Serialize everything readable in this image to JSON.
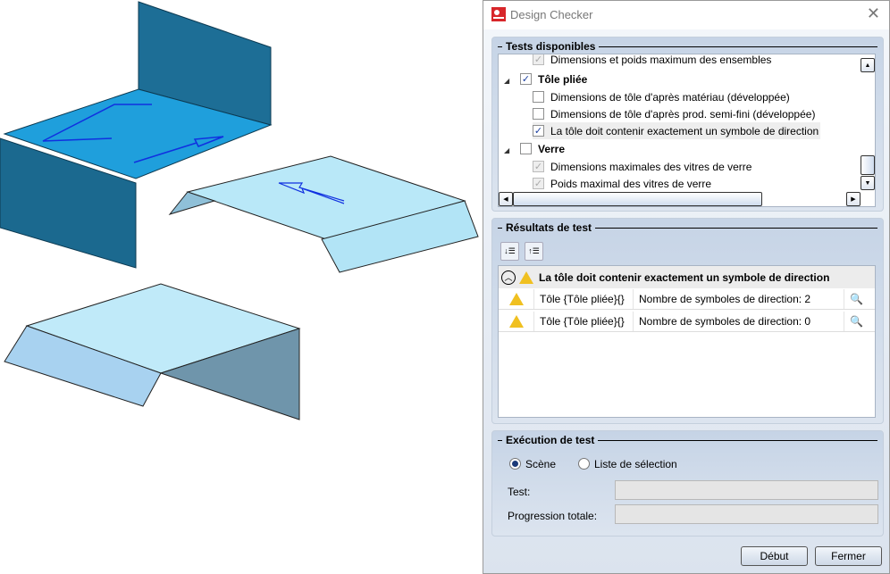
{
  "window": {
    "title": "Design Checker",
    "close": "✕"
  },
  "tests": {
    "title": "Tests disponibles",
    "items": [
      {
        "label": "Dimensions et poids maximum des ensembles",
        "checked": true,
        "disabled": true
      },
      {
        "label": "Tôle pliée",
        "checked": true,
        "group": true
      },
      {
        "label": "Dimensions de tôle d'après matériau (développée)",
        "checked": false
      },
      {
        "label": "Dimensions de tôle d'après prod. semi-fini (développée)",
        "checked": false
      },
      {
        "label": "La tôle doit contenir exactement un symbole de direction",
        "checked": true
      },
      {
        "label": "Verre",
        "checked": false,
        "group": true
      },
      {
        "label": "Dimensions maximales des vitres de verre",
        "checked": true,
        "disabled": true
      },
      {
        "label": "Poids maximal des vitres de verre",
        "checked": true,
        "disabled": true
      }
    ]
  },
  "results": {
    "title": "Résultats de test",
    "header": "La tôle doit contenir exactement un symbole de direction",
    "rows": [
      {
        "object": "Tôle {Tôle pliée}{}",
        "message": "Nombre de symboles de direction: 2"
      },
      {
        "object": "Tôle {Tôle pliée}{}",
        "message": "Nombre de symboles de direction: 0"
      }
    ]
  },
  "execution": {
    "title": "Exécution de test",
    "radio_scene": "Scène",
    "radio_selection": "Liste de sélection",
    "scene_selected": true,
    "test_label": "Test:",
    "progress_label": "Progression totale:",
    "test_value": "",
    "progress_value": ""
  },
  "buttons": {
    "start": "Début",
    "close": "Fermer"
  },
  "check": "✓"
}
